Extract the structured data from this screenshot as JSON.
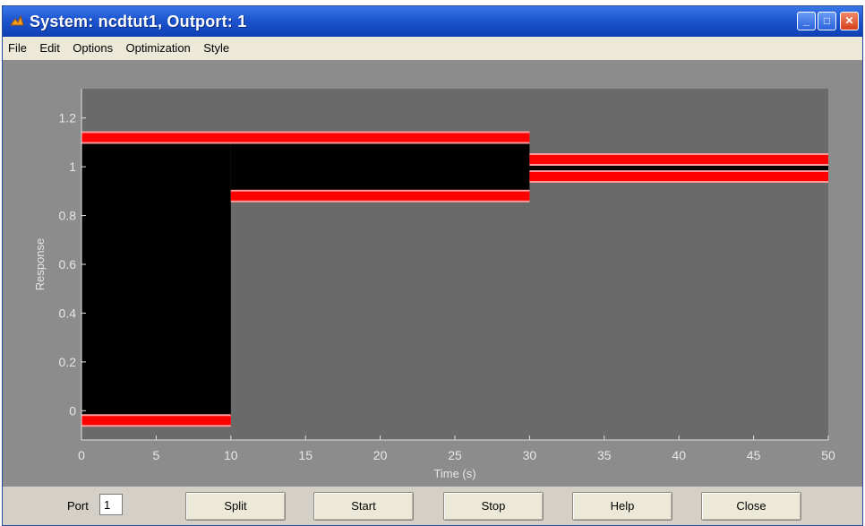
{
  "window": {
    "title": "System: ncdtut1, Outport: 1"
  },
  "menu": {
    "items": [
      "File",
      "Edit",
      "Options",
      "Optimization",
      "Style"
    ]
  },
  "colors": {
    "plot_bg": "#6a6a6a",
    "constraint_region": "#000000",
    "constraint_line": "#ff0000",
    "figure_bg": "#8c8c8c",
    "tick_text": "#e6e6e6"
  },
  "chart_data": {
    "type": "line",
    "xlabel": "Time (s)",
    "ylabel": "Response",
    "xlim": [
      0,
      50
    ],
    "ylim": [
      -0.12,
      1.32
    ],
    "xticks": [
      0,
      5,
      10,
      15,
      20,
      25,
      30,
      35,
      40,
      45,
      50
    ],
    "yticks": [
      0,
      0.2,
      0.4,
      0.6,
      0.8,
      1,
      1.2
    ],
    "grid": false,
    "constraints": {
      "upper": [
        {
          "x": [
            0,
            30
          ],
          "y": 1.12
        },
        {
          "x": [
            30,
            50
          ],
          "y": 1.03
        }
      ],
      "lower": [
        {
          "x": [
            0,
            10
          ],
          "y": -0.04
        },
        {
          "x": [
            10,
            30
          ],
          "y": 0.88
        },
        {
          "x": [
            30,
            50
          ],
          "y": 0.96
        }
      ]
    }
  },
  "controls": {
    "port_label": "Port",
    "port_value": "1",
    "buttons": {
      "split": "Split",
      "start": "Start",
      "stop": "Stop",
      "help": "Help",
      "close": "Close"
    }
  }
}
